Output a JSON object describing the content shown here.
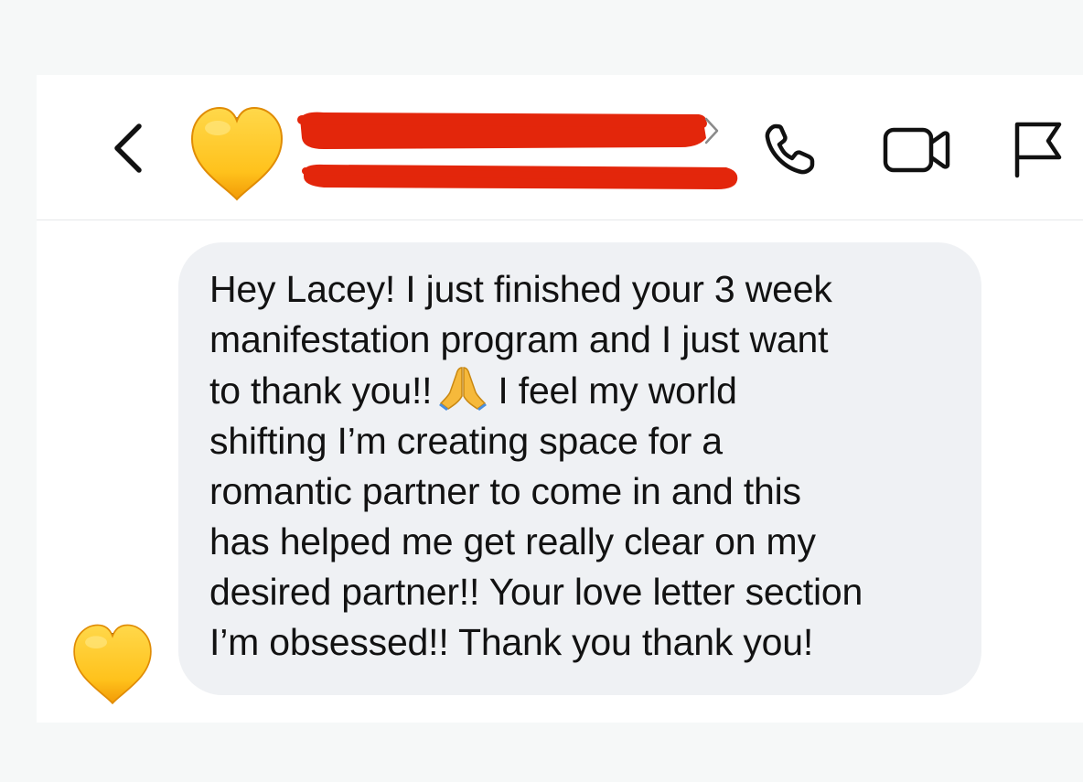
{
  "header": {
    "back_icon": "chevron-left-icon",
    "avatar_icon": "yellow-heart-icon",
    "profile_chevron_icon": "chevron-right-icon",
    "actions": [
      {
        "name": "call",
        "icon": "phone-icon"
      },
      {
        "name": "video",
        "icon": "video-camera-icon"
      },
      {
        "name": "report",
        "icon": "flag-icon"
      }
    ],
    "redaction_color": "#e3260b"
  },
  "message": {
    "avatar_icon": "yellow-heart-icon",
    "text_before_emoji": "Hey Lacey! I just finished your 3 week\nmanifestation program and I just want\nto thank you!!",
    "emoji": "folded-hands-icon",
    "text_after_emoji": "I feel my world\nshifting I’m creating space for a\nromantic partner to come in and this\nhas helped me get really clear on my\ndesired partner!! Your love letter section\nI’m obsessed!! Thank you thank you!",
    "bubble_color": "#eff1f4",
    "text_color": "#121212"
  },
  "colors": {
    "background": "#f6f8f8",
    "surface": "#ffffff",
    "heart_yellow": "#ffcc22",
    "heart_orange": "#f3a30b",
    "icon_dark": "#111111"
  }
}
